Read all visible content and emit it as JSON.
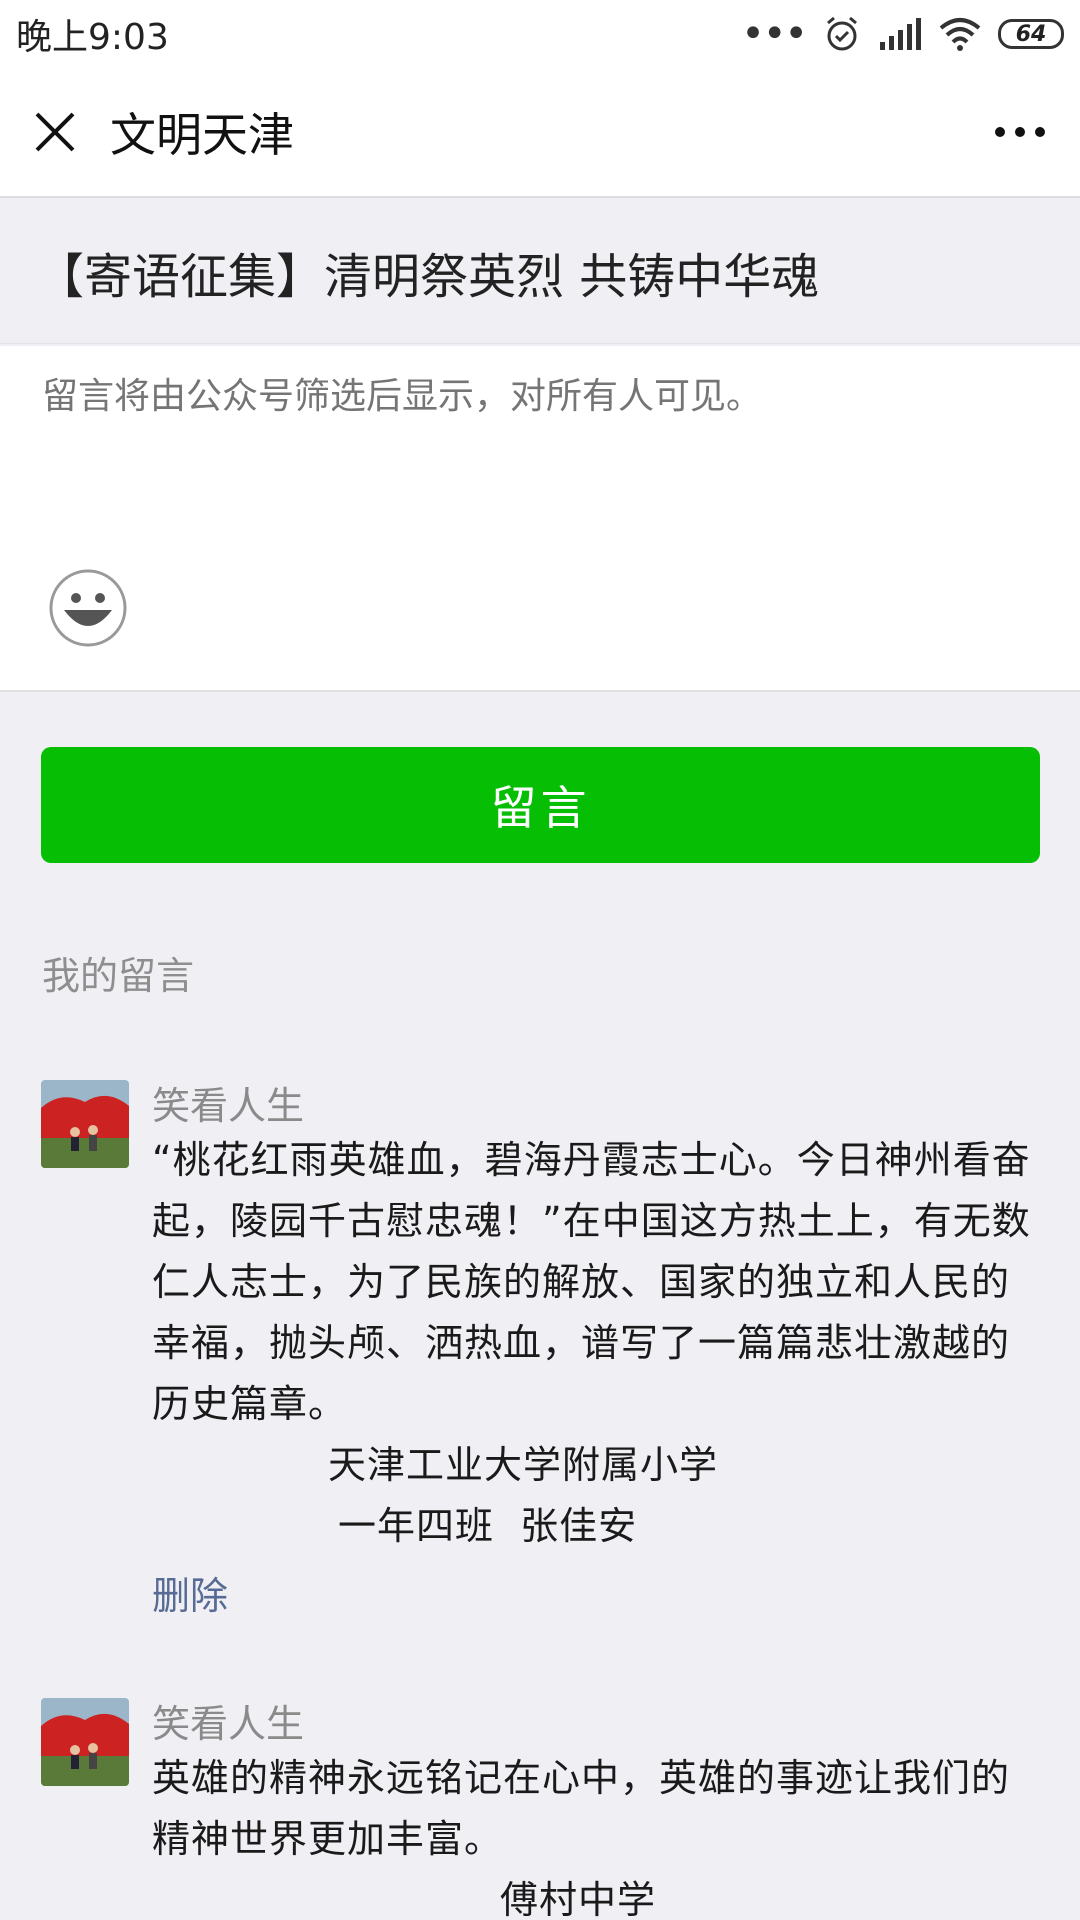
{
  "status_bar": {
    "time": "晚上9:03",
    "battery": "64",
    "icons": [
      "more-dots-icon",
      "alarm-icon",
      "signal-icon",
      "wifi-icon",
      "battery-icon"
    ]
  },
  "nav": {
    "title": "文明天津",
    "close_icon": "close-icon",
    "more_icon": "more-icon"
  },
  "article": {
    "title": "【寄语征集】清明祭英烈 共铸中华魂"
  },
  "compose": {
    "placeholder": "留言将由公众号筛选后显示，对所有人可见。",
    "emoji_icon": "smiley-icon"
  },
  "submit_label": "留言",
  "my_comments_label": "我的留言",
  "comments": [
    {
      "name": "笑看人生",
      "text": "“桃花红雨英雄血，碧海丹霞志士心。今日神州看奋起，陵园千古慰忠魂！”在中国这方热土上，有无数仁人志士，为了民族的解放、国家的独立和人民的幸福，抛头颅、洒热血，谱写了一篇篇悲壮激越的历史篇章。",
      "sig1": "天津工业大学附属小学",
      "sig2": "一年四班  张佳安",
      "delete": "删除"
    },
    {
      "name": "笑看人生",
      "text": "英雄的精神永远铭记在心中，英雄的事迹让我们的精神世界更加丰富。",
      "sig1": "傅村中学"
    }
  ],
  "colors": {
    "accent_green": "#06be04",
    "link_blue": "#576b95",
    "background": "#efeff4"
  }
}
